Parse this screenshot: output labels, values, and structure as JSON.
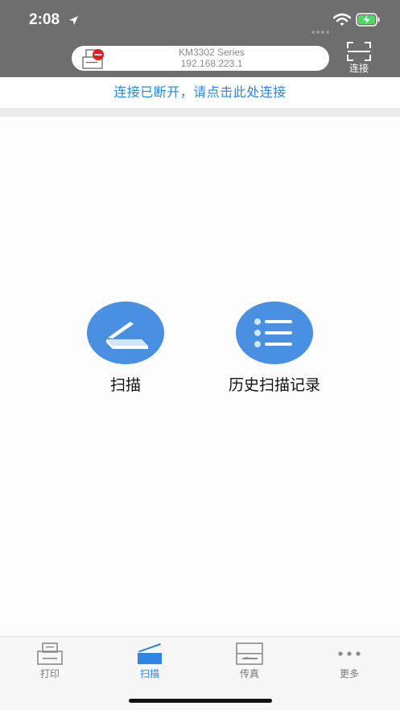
{
  "status_bar": {
    "time": "2:08",
    "icons": [
      "location-arrow-icon",
      "signal-icon",
      "wifi-icon",
      "battery-charging-icon"
    ]
  },
  "header": {
    "printer_model": "KM3302 Series",
    "printer_ip": "192.168.223.1",
    "printer_icon": "printer-disconnected-icon",
    "connect_label": "连接",
    "connect_icon": "scan-frame-icon"
  },
  "notice": {
    "text": "连接已断开，请点击此处连接"
  },
  "actions": [
    {
      "label": "扫描",
      "icon": "scanner-icon"
    },
    {
      "label": "历史扫描记录",
      "icon": "list-icon"
    }
  ],
  "tabs": [
    {
      "label": "打印",
      "icon": "printer-icon",
      "active": false
    },
    {
      "label": "扫描",
      "icon": "scanner-icon",
      "active": true
    },
    {
      "label": "传真",
      "icon": "fax-icon",
      "active": false
    },
    {
      "label": "更多",
      "icon": "more-dots-icon",
      "active": false
    }
  ],
  "colors": {
    "header_bg": "#6e6e6e",
    "accent": "#2f86e0",
    "action_circle": "#4a90e2",
    "battery_green": "#4cd964",
    "error_red": "#e02020"
  }
}
